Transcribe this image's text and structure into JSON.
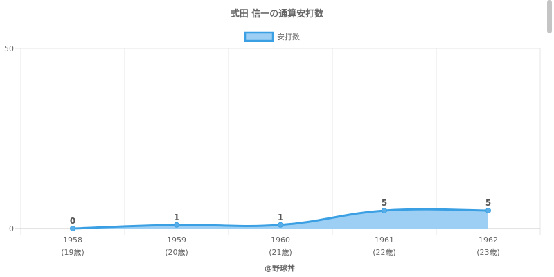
{
  "chart_data": {
    "type": "area",
    "title": "式田 信一の通算安打数",
    "categories": [
      "1958",
      "1959",
      "1960",
      "1961",
      "1962"
    ],
    "sublabels": [
      "(19歳)",
      "(20歳)",
      "(21歳)",
      "(22歳)",
      "(23歳)"
    ],
    "series": [
      {
        "name": "安打数",
        "values": [
          0,
          1,
          1,
          5,
          5
        ]
      }
    ],
    "ylim": [
      0,
      50
    ],
    "yticks": [
      "0",
      "50"
    ],
    "data_labels": [
      "0",
      "1",
      "1",
      "5",
      "5"
    ],
    "grid": true,
    "legend": "top-center",
    "credit": "@野球丼",
    "colors": {
      "line": "#3ba0e3",
      "fill": "#9ccff3",
      "point": "#5aaee8",
      "grid": "#e6e6e6",
      "axis": "#c8c8c8"
    }
  }
}
